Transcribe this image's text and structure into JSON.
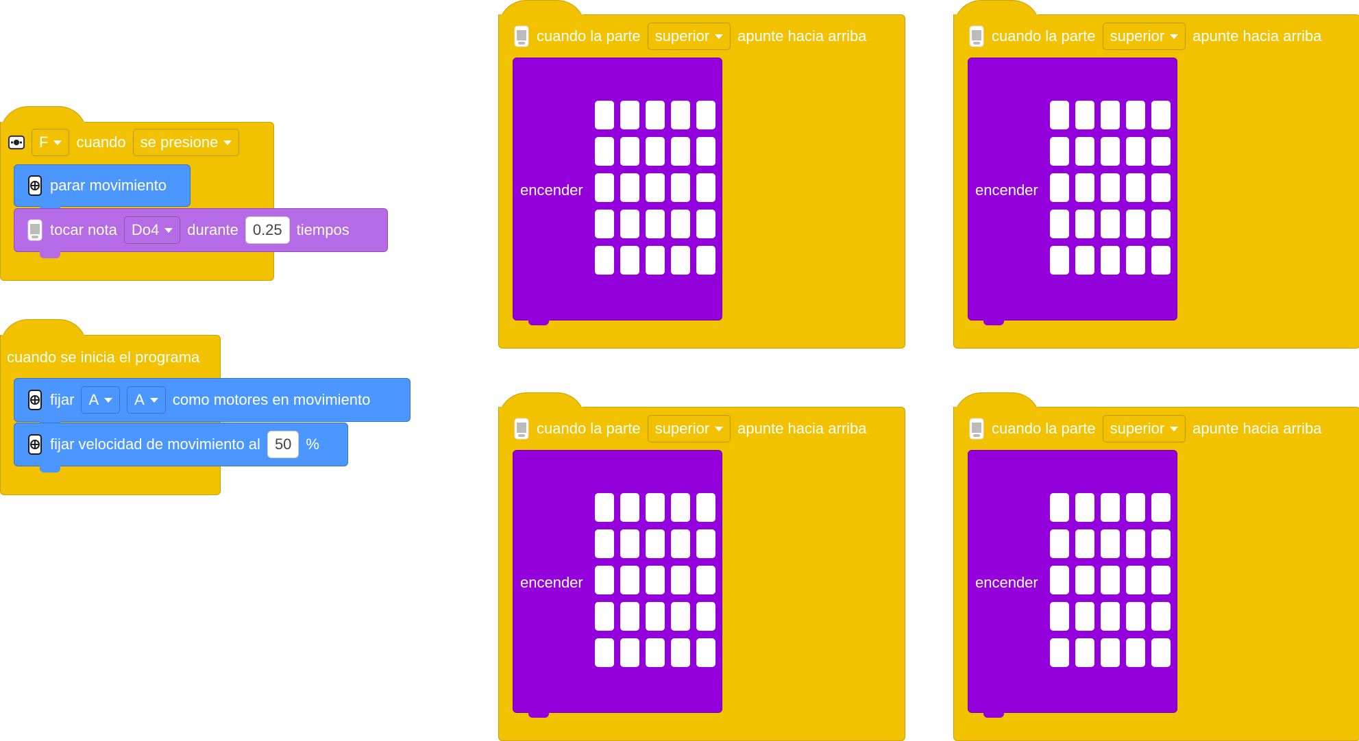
{
  "stack_button": {
    "port_dropdown": "F",
    "when_label": "cuando",
    "event_dropdown": "se presione",
    "stop_block": {
      "label": "parar movimiento"
    },
    "note_block": {
      "prefix": "tocar nota",
      "note_dropdown": "Do4",
      "during_label": "durante",
      "duration_value": "0.25",
      "suffix": "tiempos"
    }
  },
  "stack_start": {
    "hat_label": "cuando se inicia el programa",
    "set_motors": {
      "prefix": "fijar",
      "motor_left": "A",
      "motor_right": "A",
      "suffix": "como motores en movimiento"
    },
    "set_speed": {
      "prefix": "fijar velocidad de movimiento al",
      "value": "50",
      "unit": "%"
    }
  },
  "gesture_stacks": [
    {
      "prefix": "cuando la parte",
      "dropdown": "superior",
      "suffix": "apunte hacia arriba",
      "body_label": "encender"
    },
    {
      "prefix": "cuando la parte",
      "dropdown": "superior",
      "suffix": "apunte hacia arriba",
      "body_label": "encender"
    },
    {
      "prefix": "cuando la parte",
      "dropdown": "superior",
      "suffix": "apunte hacia arriba",
      "body_label": "encender"
    },
    {
      "prefix": "cuando la parte",
      "dropdown": "superior",
      "suffix": "apunte hacia arriba",
      "body_label": "encender"
    }
  ],
  "colors": {
    "events": "#F2C200",
    "motion": "#4C97FF",
    "sound": "#B56AE6",
    "light": "#9300DB"
  },
  "icons": [
    "button-icon",
    "motor-icon",
    "hub-icon"
  ]
}
